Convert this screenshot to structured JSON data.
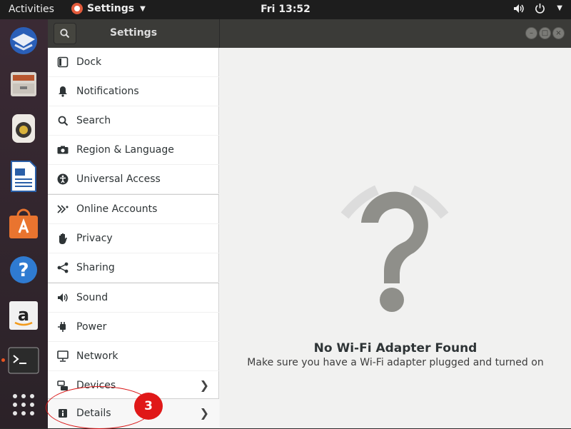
{
  "topbar": {
    "activities": "Activities",
    "app_name": "Settings",
    "clock": "Fri 13:52"
  },
  "window": {
    "title": "Settings"
  },
  "sidebar": {
    "items": [
      {
        "label": "Dock",
        "icon": "dock-icon"
      },
      {
        "label": "Notifications",
        "icon": "bell-icon"
      },
      {
        "label": "Search",
        "icon": "search-icon"
      },
      {
        "label": "Region & Language",
        "icon": "camera-icon"
      },
      {
        "label": "Universal Access",
        "icon": "accessibility-icon"
      },
      {
        "label": "Online Accounts",
        "icon": "online-accounts-icon"
      },
      {
        "label": "Privacy",
        "icon": "hand-icon"
      },
      {
        "label": "Sharing",
        "icon": "share-icon"
      },
      {
        "label": "Sound",
        "icon": "speaker-icon"
      },
      {
        "label": "Power",
        "icon": "power-plug-icon"
      },
      {
        "label": "Network",
        "icon": "network-icon"
      },
      {
        "label": "Devices",
        "icon": "devices-icon"
      },
      {
        "label": "Details",
        "icon": "info-icon"
      }
    ]
  },
  "main": {
    "title": "No Wi-Fi Adapter Found",
    "subtitle": "Make sure you have a Wi-Fi adapter plugged and turned on"
  },
  "annotation": {
    "badge": "3",
    "color": "#e01818"
  },
  "colors": {
    "header": "#3b3b38",
    "topbar": "#1d1d1d",
    "accent": "#e95420"
  }
}
